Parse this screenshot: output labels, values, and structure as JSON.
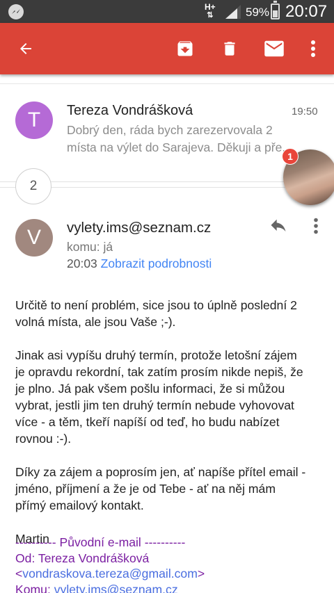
{
  "status_bar": {
    "network": "H+",
    "battery": "59%",
    "clock": "20:07",
    "icons": [
      "messenger-icon",
      "network-arrows-icon",
      "signal-icon",
      "battery-icon"
    ]
  },
  "toolbar": {
    "color": "#db4437",
    "icons": [
      "back-arrow-icon",
      "archive-icon",
      "trash-icon",
      "mail-icon",
      "more-vert-icon"
    ]
  },
  "collapsed_message": {
    "avatar_letter": "T",
    "avatar_color": "#b56ad6",
    "sender": "Tereza Vondrášková",
    "time": "19:50",
    "snippet_line1": "Dobrý den, ráda bych zarezervovala 2",
    "snippet_line2": "místa na výlet do Sarajeva. Děkuji a pře..."
  },
  "hidden_count": "2",
  "chat_head": {
    "badge": "1"
  },
  "open_message": {
    "avatar_letter": "V",
    "avatar_color": "#a1887f",
    "from": "vylety.ims@seznam.cz",
    "to": "komu: já",
    "time": "20:03",
    "details_link": "Zobrazit podrobnosti",
    "body": {
      "p1_l1": "Určitě to není problém, sice jsou to úplně poslední 2",
      "p1_l2": "volná místa, ale jsou Vaše ;-).",
      "p2_l1": "Jinak asi vypíšu druhý termín, protože letošní zájem",
      "p2_l2": "je opravdu rekordní, tak zatím prosím nikde nepiš, že",
      "p2_l3": "je plno. Já pak všem pošlu informaci, že si můžou",
      "p2_l4": "vybrat, jestli jim ten druhý termín nebude vyhovovat",
      "p2_l5": "více - a těm, tkeří napíší od teď, ho budu nabízet",
      "p2_l6": "rovnou :-).",
      "p3_l1": "Díky za zájem a poprosím jen, ať napíše přítel email -",
      "p3_l2": "jméno, příjmení a že je od Tebe - ať na něj mám",
      "p3_l3": "přímý emailový kontakt.",
      "signature": "Martin"
    },
    "quoted": {
      "header": "---------- Původní e-mail ----------",
      "from_label": "Od: Tereza Vondrášková",
      "from_open": "<",
      "from_email": "vondraskova.tereza@gmail.com",
      "from_close": ">",
      "to_label": "Komu: ",
      "to_email": "vylety.ims@seznam.cz"
    }
  }
}
